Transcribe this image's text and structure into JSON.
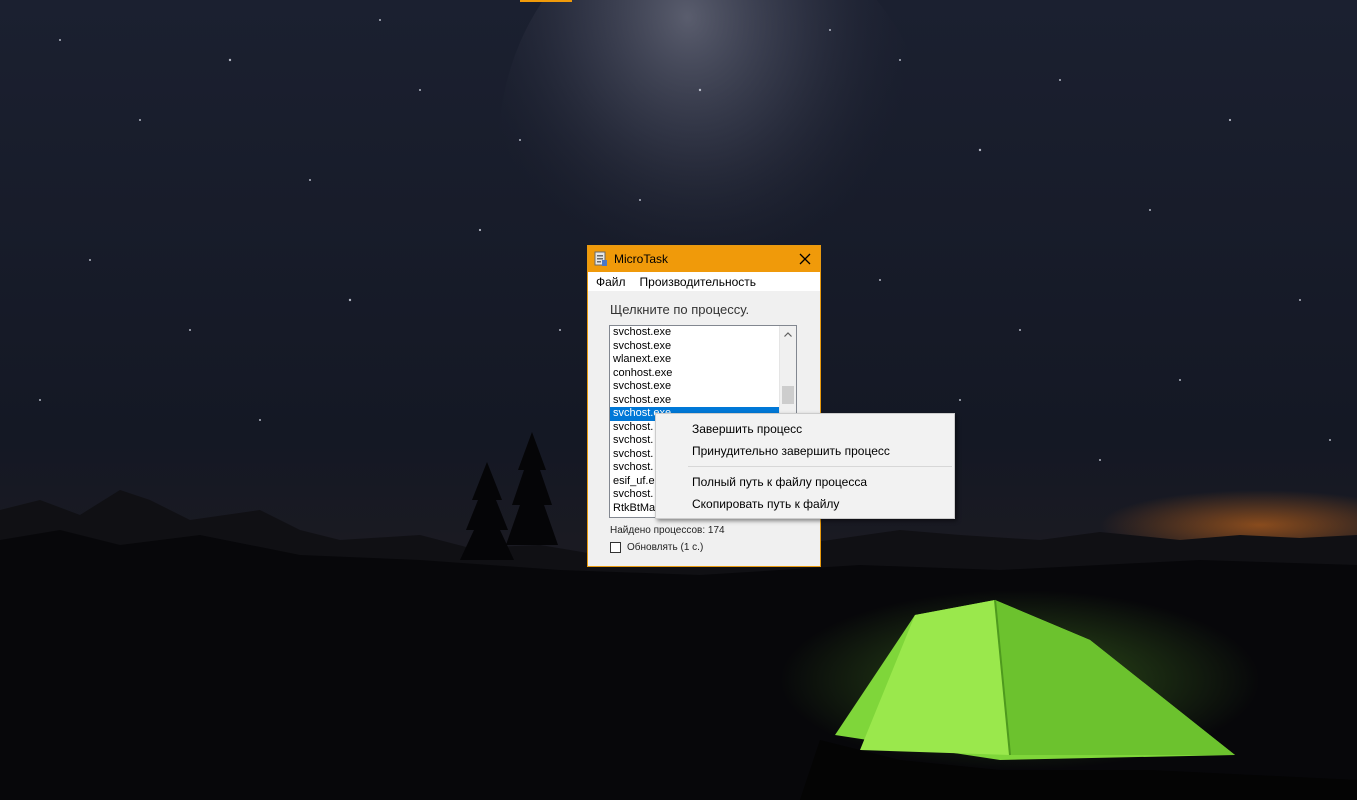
{
  "window": {
    "title": "MicroTask",
    "icon": "app-icon",
    "close_icon": "close-icon",
    "accent": "#f09a0a"
  },
  "menu": {
    "file": "Файл",
    "performance": "Производительность"
  },
  "hint": "Щелкните по процессу.",
  "processes": [
    "svchost.exe",
    "svchost.exe",
    "wlanext.exe",
    "conhost.exe",
    "svchost.exe",
    "svchost.exe",
    "svchost.exe",
    "svchost.",
    "svchost.",
    "svchost.",
    "svchost.",
    "esif_uf.e",
    "svchost.",
    "RtkBtMa"
  ],
  "selected_index": 6,
  "status": "Найдено процессов: 174",
  "refresh_label": "Обновлять (1 с.)",
  "refresh_checked": false,
  "context_menu": {
    "end_process": "Завершить процесс",
    "force_end": "Принудительно завершить процесс",
    "full_path": "Полный путь к файлу процесса",
    "copy_path": "Скопировать путь к файлу"
  }
}
